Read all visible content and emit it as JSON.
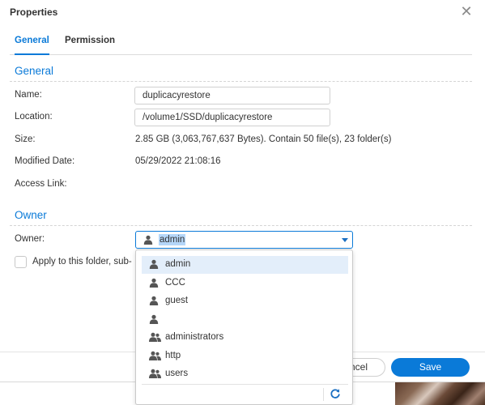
{
  "window": {
    "title": "Properties",
    "close_glyph": "✕"
  },
  "tabs": [
    {
      "label": "General",
      "active": true
    },
    {
      "label": "Permission",
      "active": false
    }
  ],
  "general": {
    "section_title": "General",
    "name_label": "Name:",
    "name_value": "duplicacyrestore",
    "location_label": "Location:",
    "location_value": "/volume1/SSD/duplicacyrestore",
    "size_label": "Size:",
    "size_value": "2.85 GB (3,063,767,637 Bytes). Contain 50 file(s), 23 folder(s)",
    "modified_label": "Modified Date:",
    "modified_value": "05/29/2022 21:08:16",
    "access_link_label": "Access Link:"
  },
  "owner": {
    "section_title": "Owner",
    "owner_label": "Owner:",
    "selected_value": "admin",
    "apply_label": "Apply to this folder, sub-",
    "apply_checked": false
  },
  "dropdown": {
    "items": [
      {
        "label": "admin",
        "icon": "user-icon",
        "selected": true
      },
      {
        "label": "CCC",
        "icon": "user-icon",
        "selected": false
      },
      {
        "label": "guest",
        "icon": "user-icon",
        "selected": false
      },
      {
        "label": "",
        "icon": "user-icon",
        "selected": false
      },
      {
        "label": "administrators",
        "icon": "group-icon",
        "selected": false
      },
      {
        "label": "http",
        "icon": "group-icon",
        "selected": false
      },
      {
        "label": "users",
        "icon": "group-icon",
        "selected": false
      }
    ],
    "refresh_icon": "refresh-icon"
  },
  "footer": {
    "cancel_label": "Cancel",
    "cancel_visible_text": "ncel",
    "save_label": "Save"
  },
  "colors": {
    "accent": "#0a7ad8",
    "selected_row": "#e3eefa",
    "text_highlight": "#b5d6f8"
  }
}
